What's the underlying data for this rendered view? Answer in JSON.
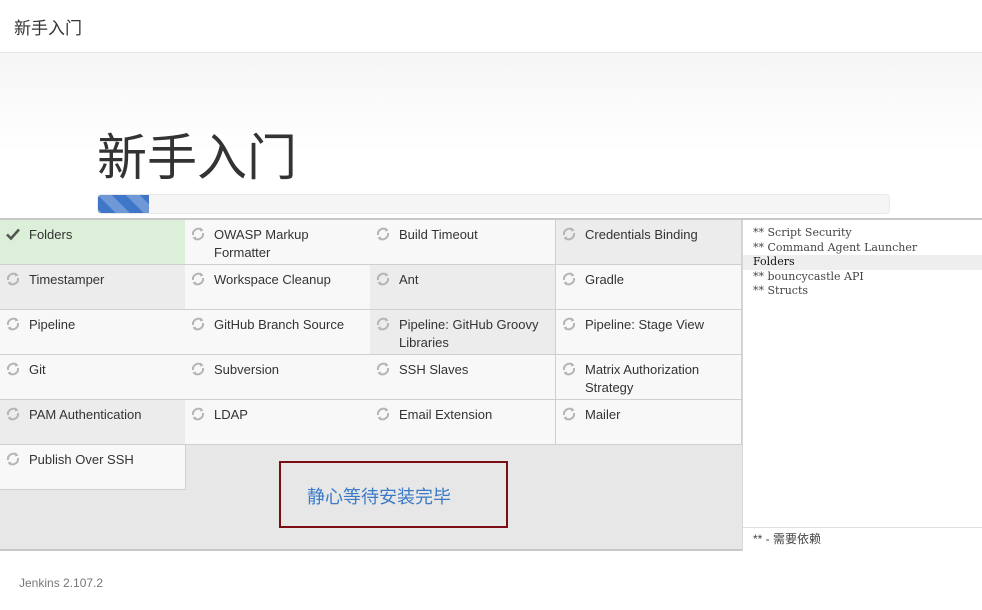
{
  "header": {
    "title": "新手入门"
  },
  "hero": {
    "title": "新手入门",
    "progress_percent": 6.5
  },
  "plugins": [
    {
      "label": "Folders",
      "status": "done"
    },
    {
      "label": "OWASP Markup Formatter",
      "status": "pending"
    },
    {
      "label": "Build Timeout",
      "status": "pending"
    },
    {
      "label": "Credentials Binding",
      "status": "pending"
    },
    {
      "label": "Timestamper",
      "status": "pending"
    },
    {
      "label": "Workspace Cleanup",
      "status": "pending"
    },
    {
      "label": "Ant",
      "status": "pending"
    },
    {
      "label": "Gradle",
      "status": "pending"
    },
    {
      "label": "Pipeline",
      "status": "pending"
    },
    {
      "label": "GitHub Branch Source",
      "status": "pending"
    },
    {
      "label": "Pipeline: GitHub Groovy Libraries",
      "status": "pending"
    },
    {
      "label": "Pipeline: Stage View",
      "status": "pending"
    },
    {
      "label": "Git",
      "status": "pending"
    },
    {
      "label": "Subversion",
      "status": "pending"
    },
    {
      "label": "SSH Slaves",
      "status": "pending"
    },
    {
      "label": "Matrix Authorization Strategy",
      "status": "pending"
    },
    {
      "label": "PAM Authentication",
      "status": "pending"
    },
    {
      "label": "LDAP",
      "status": "pending"
    },
    {
      "label": "Email Extension",
      "status": "pending"
    },
    {
      "label": "Mailer",
      "status": "pending"
    },
    {
      "label": "Publish Over SSH",
      "status": "pending"
    }
  ],
  "wait_message": "静心等待安装完毕",
  "log": {
    "lines": [
      "** Script Security",
      "** Command Agent Launcher",
      "Folders",
      "** bouncycastle API",
      "** Structs"
    ],
    "highlight_index": 2,
    "legend": "** - 需要依赖"
  },
  "footer": {
    "version": "Jenkins 2.107.2"
  },
  "icons": {
    "done": "check-icon",
    "pending": "refresh-icon"
  },
  "colors": {
    "done_bg": "#dcefd9",
    "progress": "#3f76c8",
    "wait_border": "#7a0e14",
    "wait_text": "#3b7ac9"
  }
}
